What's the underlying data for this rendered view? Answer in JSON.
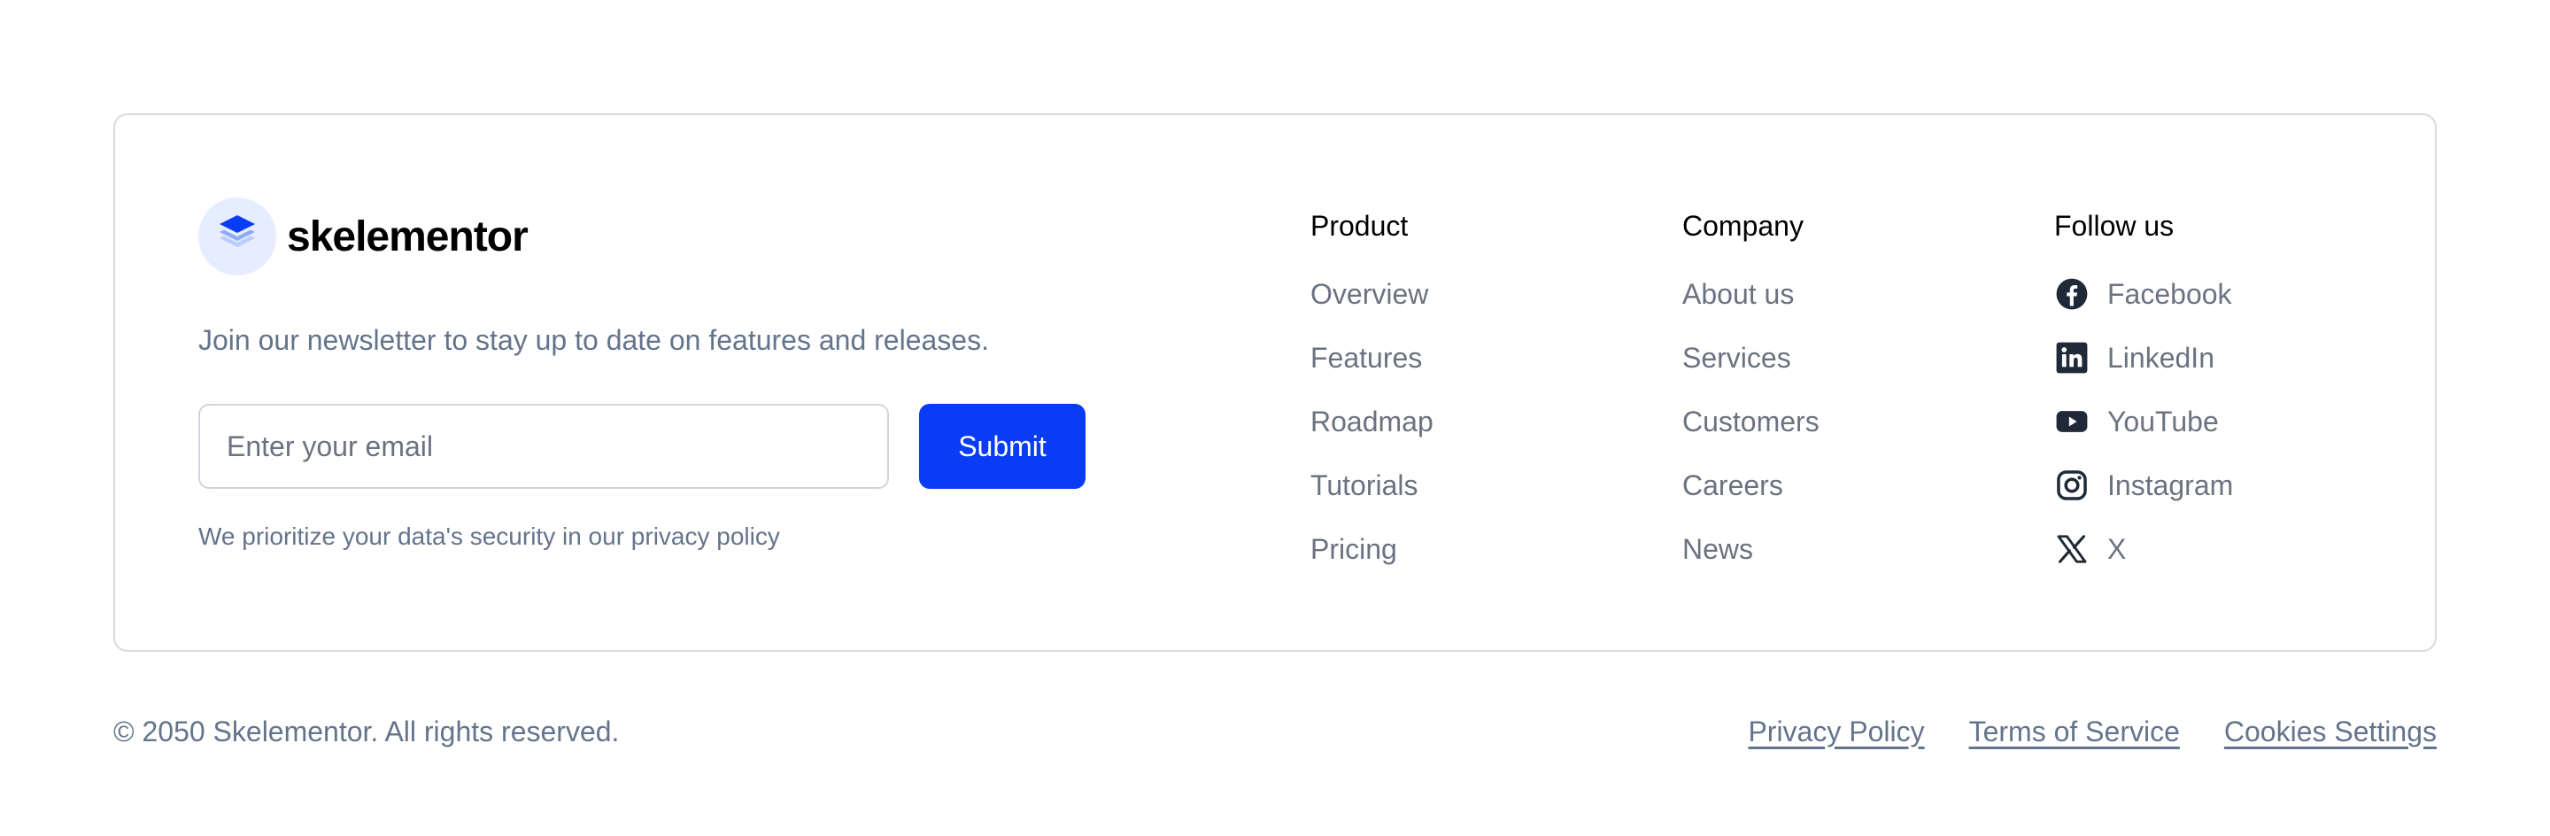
{
  "brand": {
    "name": "skelementor",
    "logo_icon": "layers-icon",
    "logo_bg": "#e6edfe",
    "logo_color": "#0b3cf5"
  },
  "newsletter": {
    "text": "Join our newsletter to stay up to date on features and releases.",
    "email_placeholder": "Enter your email",
    "email_value": "",
    "submit_label": "Submit",
    "privacy_note": "We prioritize your data's security in our privacy policy"
  },
  "columns": {
    "product": {
      "title": "Product",
      "links": [
        "Overview",
        "Features",
        "Roadmap",
        "Tutorials",
        "Pricing"
      ]
    },
    "company": {
      "title": "Company",
      "links": [
        "About us",
        "Services",
        "Customers",
        "Careers",
        "News"
      ]
    },
    "follow": {
      "title": "Follow us",
      "links": [
        {
          "label": "Facebook",
          "icon": "facebook-icon"
        },
        {
          "label": "LinkedIn",
          "icon": "linkedin-icon"
        },
        {
          "label": "YouTube",
          "icon": "youtube-icon"
        },
        {
          "label": "Instagram",
          "icon": "instagram-icon"
        },
        {
          "label": "X",
          "icon": "x-icon"
        }
      ]
    }
  },
  "bottom": {
    "copyright": "© 2050 Skelementor. All rights reserved.",
    "links": [
      "Privacy Policy",
      "Terms of Service",
      "Cookies Settings"
    ]
  },
  "colors": {
    "accent": "#0b3cf5",
    "muted_text": "#64748b",
    "border": "#d8dbe0",
    "icon": "#1f2937"
  }
}
